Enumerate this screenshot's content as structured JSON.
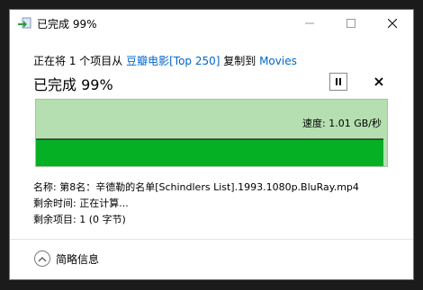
{
  "window": {
    "title": "已完成 99%"
  },
  "copy": {
    "prefix": "正在将 1 个项目从 ",
    "source": "豆瓣电影[Top 250]",
    "middle": " 复制到 ",
    "destination": "Movies",
    "status_title": "已完成 99%",
    "progress_percent": 99
  },
  "graph": {
    "speed_label": "速度: 1.01 GB/秒",
    "fill_color": "#06b025",
    "background_color": "#b5dfb0"
  },
  "details": {
    "name_line": "名称: 第8名：辛德勒的名单[Schindlers List].1993.1080p.BluRay.mp4",
    "time_line": "剩余时间: 正在计算...",
    "items_line": "剩余项目: 1 (0 字节)"
  },
  "footer": {
    "collapse_label": "简略信息"
  },
  "icons": {
    "app": "copy-arrow-icon",
    "minimize": "minimize-icon",
    "maximize": "maximize-icon",
    "close": "close-icon",
    "pause": "pause-icon",
    "cancel": "cancel-icon",
    "collapse": "chevron-up-icon"
  }
}
